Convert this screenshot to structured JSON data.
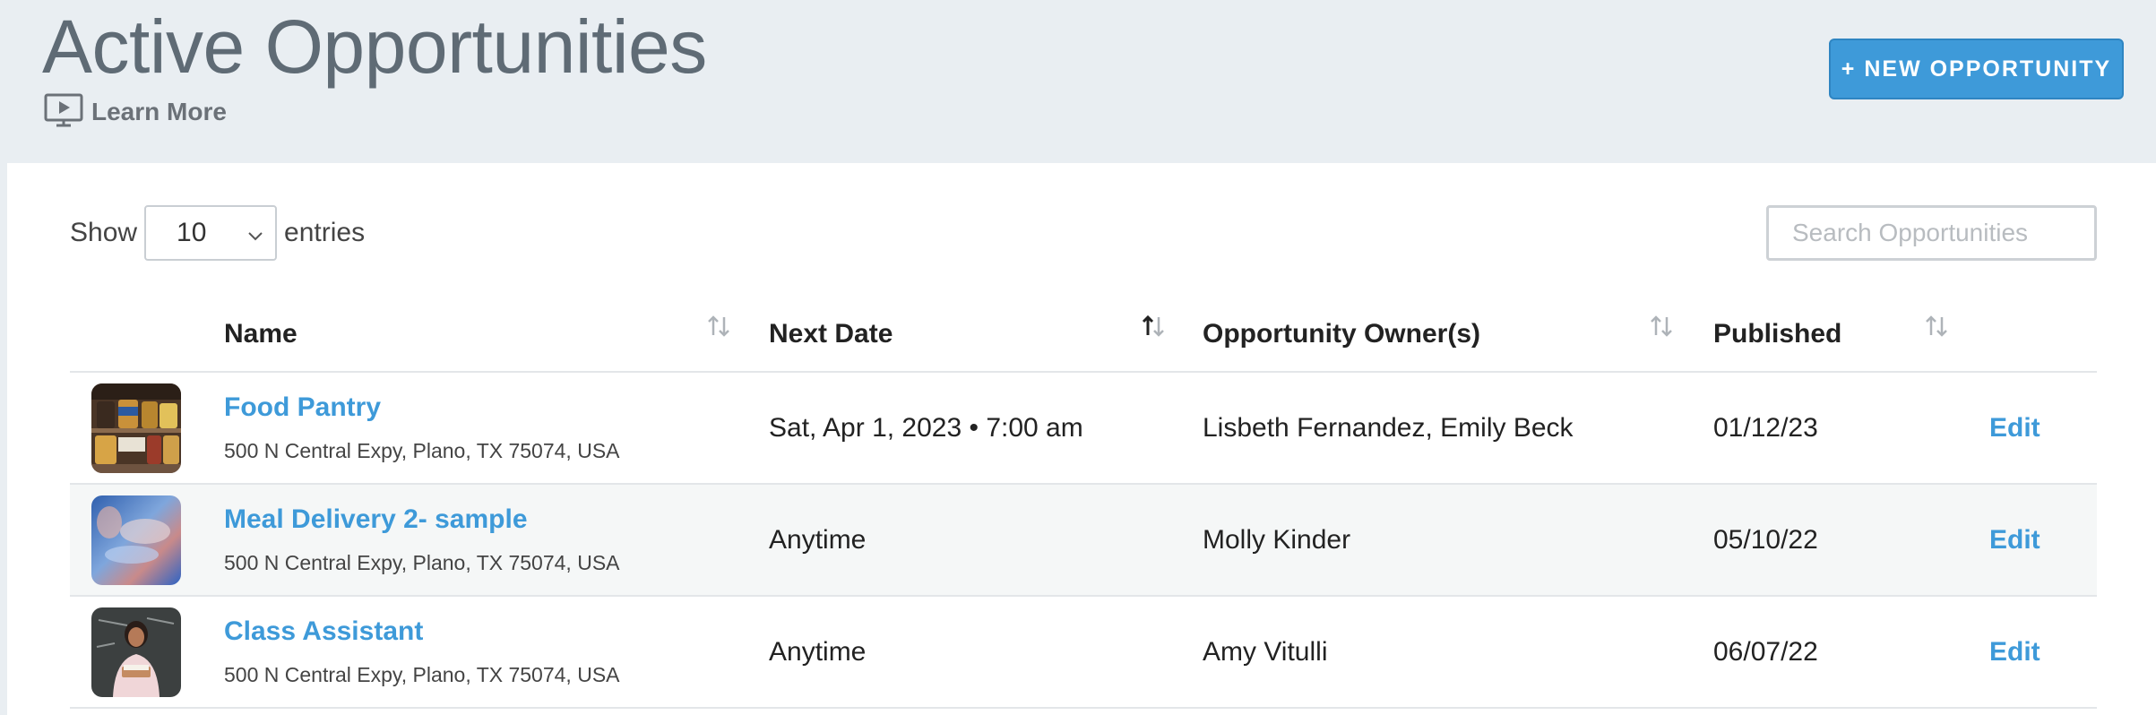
{
  "header": {
    "title": "Active Opportunities",
    "learn_more_label": "Learn More",
    "new_button_label": "+ NEW OPPORTUNITY"
  },
  "controls": {
    "show_label": "Show",
    "entries_value": "10",
    "entries_label": "entries",
    "search_placeholder": "Search Opportunities",
    "search_value": ""
  },
  "table": {
    "columns": [
      {
        "label": "Name",
        "sort": "none"
      },
      {
        "label": "Next Date",
        "sort": "ascending"
      },
      {
        "label": "Opportunity Owner(s)",
        "sort": "none"
      },
      {
        "label": "Published",
        "sort": "none"
      }
    ],
    "rows": [
      {
        "name": "Food Pantry",
        "address": "500 N Central Expy, Plano, TX 75074, USA",
        "next_date": "Sat, Apr 1, 2023 • 7:00 am",
        "owners": "Lisbeth Fernandez, Emily Beck",
        "published": "01/12/23",
        "action": "Edit",
        "thumb": "food-pantry-shelves"
      },
      {
        "name": "Meal Delivery 2- sample",
        "address": "500 N Central Expy, Plano, TX 75074, USA",
        "next_date": "Anytime",
        "owners": "Molly Kinder",
        "published": "05/10/22",
        "action": "Edit",
        "thumb": "meal-delivery-blur"
      },
      {
        "name": "Class Assistant",
        "address": "500 N Central Expy, Plano, TX 75074, USA",
        "next_date": "Anytime",
        "owners": "Amy Vitulli",
        "published": "06/07/22",
        "action": "Edit",
        "thumb": "teacher-at-chalkboard"
      }
    ]
  },
  "colors": {
    "accent": "#3e9ad9",
    "header_bg": "#e9eef2",
    "row_alt_bg": "#f5f7f7",
    "title_gray": "#5f6b75"
  },
  "icons": {
    "learn_more": "video-play-icon",
    "select": "chevron-down-icon",
    "sort": "sort-arrows-icon"
  }
}
